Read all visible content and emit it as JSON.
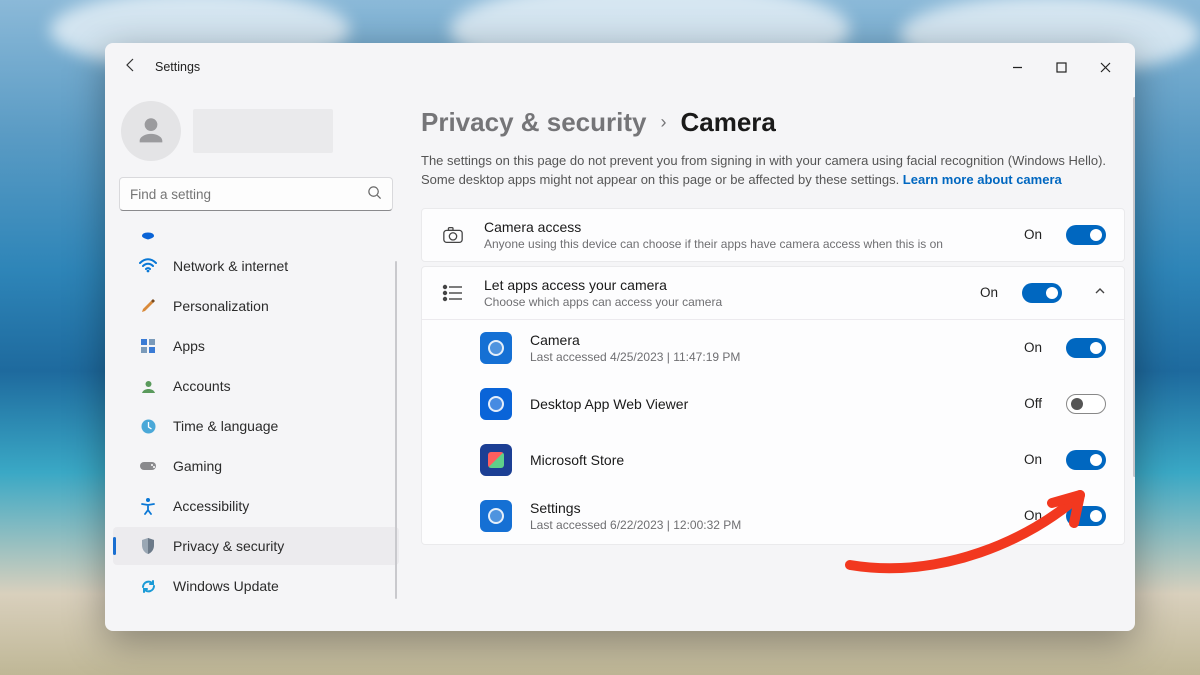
{
  "titlebar": {
    "title": "Settings"
  },
  "search": {
    "placeholder": "Find a setting"
  },
  "nav": {
    "items": [
      {
        "label": ""
      },
      {
        "label": "Network & internet"
      },
      {
        "label": "Personalization"
      },
      {
        "label": "Apps"
      },
      {
        "label": "Accounts"
      },
      {
        "label": "Time & language"
      },
      {
        "label": "Gaming"
      },
      {
        "label": "Accessibility"
      },
      {
        "label": "Privacy & security"
      },
      {
        "label": "Windows Update"
      }
    ]
  },
  "breadcrumb": {
    "parent": "Privacy & security",
    "current": "Camera"
  },
  "description": {
    "text": "The settings on this page do not prevent you from signing in with your camera using facial recognition (Windows Hello). Some desktop apps might not appear on this page or be affected by these settings.  ",
    "link": "Learn more about camera"
  },
  "camera_access": {
    "title": "Camera access",
    "sub": "Anyone using this device can choose if their apps have camera access when this is on",
    "state": "On"
  },
  "let_apps": {
    "title": "Let apps access your camera",
    "sub": "Choose which apps can access your camera",
    "state": "On"
  },
  "apps": [
    {
      "name": "Camera",
      "sub": "Last accessed 4/25/2023  |  11:47:19 PM",
      "state": "On",
      "on": true,
      "iconClass": "cam"
    },
    {
      "name": "Desktop App Web Viewer",
      "sub": "",
      "state": "Off",
      "on": false,
      "iconClass": "blue"
    },
    {
      "name": "Microsoft Store",
      "sub": "",
      "state": "On",
      "on": true,
      "iconClass": "store"
    },
    {
      "name": "Settings",
      "sub": "Last accessed 6/22/2023  |  12:00:32 PM",
      "state": "On",
      "on": true,
      "iconClass": "cam"
    }
  ]
}
